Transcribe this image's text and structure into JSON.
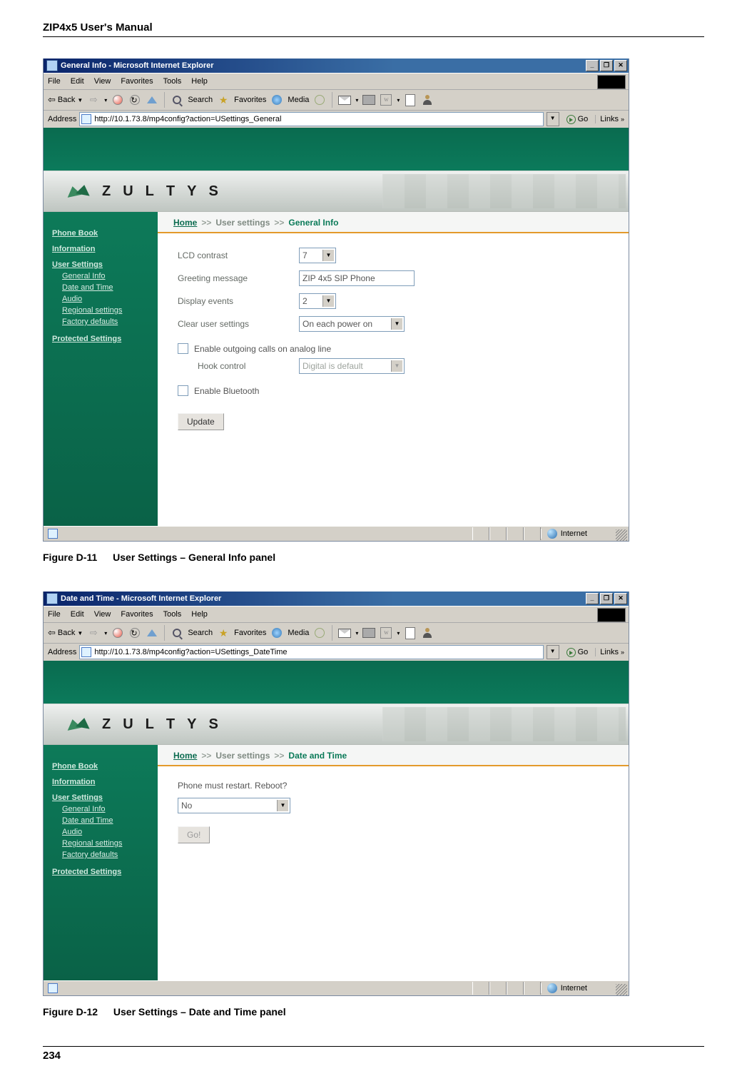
{
  "doc": {
    "header": "ZIP4x5 User's Manual",
    "footer": "234"
  },
  "figures": {
    "d11": {
      "label": "Figure D-11",
      "title": "User Settings – General Info panel"
    },
    "d12": {
      "label": "Figure D-12",
      "title": "User Settings – Date and Time panel"
    }
  },
  "menus": {
    "file": "File",
    "edit": "Edit",
    "view": "View",
    "favorites": "Favorites",
    "tools": "Tools",
    "help": "Help"
  },
  "toolbar": {
    "back": "Back",
    "search": "Search",
    "favorites": "Favorites",
    "media": "Media"
  },
  "address": {
    "label": "Address",
    "go": "Go",
    "links": "Links"
  },
  "status": {
    "zone": "Internet"
  },
  "sidebar": {
    "phonebook": "Phone Book",
    "information": "Information",
    "user_settings": "User Settings",
    "general_info": "General Info",
    "date_time": "Date and Time",
    "audio": "Audio",
    "regional": "Regional settings",
    "factory": "Factory defaults",
    "protected": "Protected Settings"
  },
  "crumb": {
    "home": "Home",
    "user_settings": "User settings",
    "general_info": "General Info",
    "date_time": "Date and Time"
  },
  "brand": {
    "letters": [
      "Z",
      "U",
      "L",
      "T",
      "Y",
      "S"
    ]
  },
  "win1": {
    "title": "General Info - Microsoft Internet Explorer",
    "url": "http://10.1.73.8/mp4config?action=USettings_General",
    "form": {
      "lcd_label": "LCD contrast",
      "lcd_value": "7",
      "greeting_label": "Greeting message",
      "greeting_value": "ZIP 4x5 SIP Phone",
      "display_events_label": "Display events",
      "display_events_value": "2",
      "clear_label": "Clear user settings",
      "clear_value": "On each power on",
      "chk_outgoing": "Enable outgoing calls on analog line",
      "hook_label": "Hook control",
      "hook_value": "Digital is default",
      "chk_bluetooth": "Enable Bluetooth",
      "update_btn": "Update"
    }
  },
  "win2": {
    "title": "Date and Time - Microsoft Internet Explorer",
    "url": "http://10.1.73.8/mp4config?action=USettings_DateTime",
    "body": {
      "prompt": "Phone must restart. Reboot?",
      "reboot_value": "No",
      "go_btn": "Go!"
    }
  }
}
